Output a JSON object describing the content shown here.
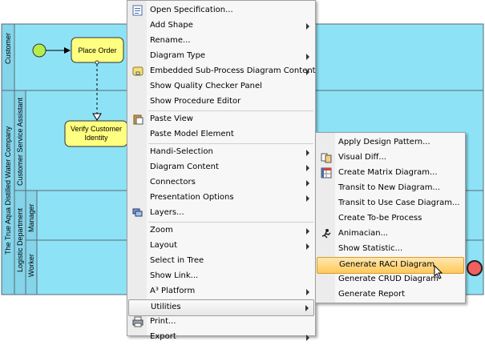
{
  "diagram": {
    "pools": [
      {
        "name": "Customer",
        "lanes": []
      },
      {
        "name": "The True Aqua Distilled Water Company",
        "lanes": [
          {
            "name": "Customer Service Assistant"
          },
          {
            "name": "Logistic Department",
            "lanes": [
              "Manager",
              "Worker"
            ]
          }
        ]
      }
    ],
    "tasks": [
      "Place Order",
      "Verify Customer Identity"
    ]
  },
  "context_menu": {
    "items": [
      {
        "label": "Open Specification...",
        "icon": "spec-icon",
        "submenu": false
      },
      {
        "label": "Add Shape",
        "submenu": true
      },
      {
        "label": "Rename...",
        "submenu": false
      },
      {
        "label": "Diagram Type",
        "submenu": true
      },
      {
        "label": "Embedded Sub-Process Diagram Content",
        "icon": "subprocess-icon",
        "submenu": true
      },
      {
        "label": "Show Quality Checker Panel",
        "submenu": false
      },
      {
        "label": "Show Procedure Editor",
        "submenu": false
      },
      {
        "separator": true
      },
      {
        "label": "Paste View",
        "icon": "paste-icon",
        "submenu": false
      },
      {
        "label": "Paste Model Element",
        "submenu": false
      },
      {
        "separator": true
      },
      {
        "label": "Handi-Selection",
        "submenu": true
      },
      {
        "label": "Diagram Content",
        "submenu": true
      },
      {
        "label": "Connectors",
        "submenu": true
      },
      {
        "label": "Presentation Options",
        "submenu": true
      },
      {
        "label": "Layers...",
        "icon": "layers-icon",
        "submenu": false
      },
      {
        "separator": true
      },
      {
        "label": "Zoom",
        "submenu": true
      },
      {
        "label": "Layout",
        "submenu": true
      },
      {
        "label": "Select in Tree",
        "submenu": false
      },
      {
        "label": "Show Link...",
        "submenu": false
      },
      {
        "label": "A³ Platform",
        "submenu": true
      },
      {
        "label": "Utilities",
        "submenu": true,
        "active": true
      },
      {
        "label": "Print...",
        "icon": "print-icon",
        "submenu": false
      },
      {
        "label": "Export",
        "submenu": true
      }
    ]
  },
  "utilities_submenu": {
    "items": [
      {
        "label": "Apply Design Pattern..."
      },
      {
        "label": "Visual Diff...",
        "icon": "visual-diff-icon"
      },
      {
        "label": "Create Matrix Diagram...",
        "icon": "matrix-icon"
      },
      {
        "label": "Transit to New Diagram..."
      },
      {
        "label": "Transit to Use Case Diagram..."
      },
      {
        "label": "Create To-be Process"
      },
      {
        "label": "Animacian...",
        "icon": "animacian-icon"
      },
      {
        "label": "Show Statistic..."
      },
      {
        "label": "Generate RACI Diagram",
        "hovered": true
      },
      {
        "label": "Generate CRUD Diagram"
      },
      {
        "label": "Generate Report"
      }
    ]
  }
}
